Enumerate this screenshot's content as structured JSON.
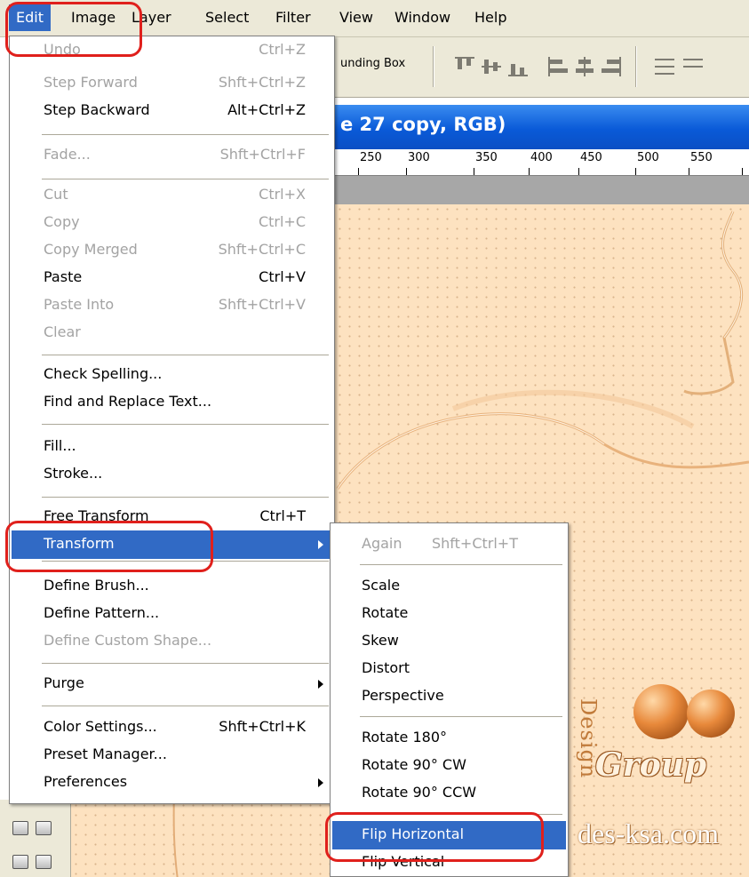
{
  "menubar": {
    "items": [
      "Edit",
      "Image",
      "Layer",
      "Select",
      "Filter",
      "View",
      "Window",
      "Help"
    ],
    "active": "Edit"
  },
  "options_bar": {
    "bounding_box_label": "unding Box"
  },
  "document": {
    "title_fragment": "e 27 copy, RGB)",
    "ruler_labels": [
      "250",
      "300",
      "350",
      "400",
      "450",
      "500",
      "550"
    ]
  },
  "edit_menu": {
    "items": [
      {
        "label": "Undo",
        "shortcut": "Ctrl+Z",
        "enabled": false
      },
      {
        "label": "Step Forward",
        "shortcut": "Shft+Ctrl+Z",
        "enabled": false
      },
      {
        "label": "Step Backward",
        "shortcut": "Alt+Ctrl+Z",
        "enabled": true
      },
      {
        "label": "Fade...",
        "shortcut": "Shft+Ctrl+F",
        "enabled": false
      },
      {
        "label": "Cut",
        "shortcut": "Ctrl+X",
        "enabled": false
      },
      {
        "label": "Copy",
        "shortcut": "Ctrl+C",
        "enabled": false
      },
      {
        "label": "Copy Merged",
        "shortcut": "Shft+Ctrl+C",
        "enabled": false
      },
      {
        "label": "Paste",
        "shortcut": "Ctrl+V",
        "enabled": true
      },
      {
        "label": "Paste Into",
        "shortcut": "Shft+Ctrl+V",
        "enabled": false
      },
      {
        "label": "Clear",
        "shortcut": "",
        "enabled": false
      },
      {
        "label": "Check Spelling...",
        "shortcut": "",
        "enabled": true
      },
      {
        "label": "Find and Replace Text...",
        "shortcut": "",
        "enabled": true
      },
      {
        "label": "Fill...",
        "shortcut": "",
        "enabled": true
      },
      {
        "label": "Stroke...",
        "shortcut": "",
        "enabled": true
      },
      {
        "label": "Free Transform",
        "shortcut": "Ctrl+T",
        "enabled": true
      },
      {
        "label": "Transform",
        "shortcut": "",
        "enabled": true,
        "highlighted": true,
        "submenu": true
      },
      {
        "label": "Define Brush...",
        "shortcut": "",
        "enabled": true
      },
      {
        "label": "Define Pattern...",
        "shortcut": "",
        "enabled": true
      },
      {
        "label": "Define Custom Shape...",
        "shortcut": "",
        "enabled": false
      },
      {
        "label": "Purge",
        "shortcut": "",
        "enabled": true,
        "submenu": true
      },
      {
        "label": "Color Settings...",
        "shortcut": "Shft+Ctrl+K",
        "enabled": true
      },
      {
        "label": "Preset Manager...",
        "shortcut": "",
        "enabled": true
      },
      {
        "label": "Preferences",
        "shortcut": "",
        "enabled": true,
        "submenu": true
      }
    ]
  },
  "transform_submenu": {
    "items": [
      {
        "label": "Again",
        "shortcut": "Shft+Ctrl+T",
        "enabled": false
      },
      {
        "label": "Scale",
        "shortcut": "",
        "enabled": true
      },
      {
        "label": "Rotate",
        "shortcut": "",
        "enabled": true
      },
      {
        "label": "Skew",
        "shortcut": "",
        "enabled": true
      },
      {
        "label": "Distort",
        "shortcut": "",
        "enabled": true
      },
      {
        "label": "Perspective",
        "shortcut": "",
        "enabled": true
      },
      {
        "label": "Rotate 180°",
        "shortcut": "",
        "enabled": true
      },
      {
        "label": "Rotate 90° CW",
        "shortcut": "",
        "enabled": true
      },
      {
        "label": "Rotate 90° CCW",
        "shortcut": "",
        "enabled": true
      },
      {
        "label": "Flip Horizontal",
        "shortcut": "",
        "enabled": true,
        "highlighted": true
      },
      {
        "label": "Flip Vertical",
        "shortcut": "",
        "enabled": true
      }
    ]
  },
  "watermark": {
    "design": "Design",
    "group": "Group",
    "site": "des-ksa.com"
  },
  "colors": {
    "highlight": "#316ac5",
    "annotation": "#e0201c",
    "menubar": "#ece9d8",
    "canvas": "#fde2c0"
  }
}
